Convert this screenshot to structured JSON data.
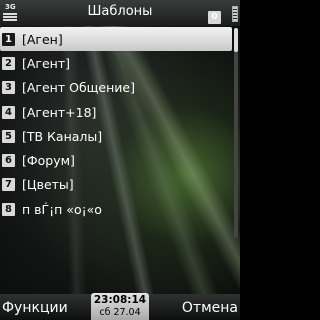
{
  "header": {
    "title": "Шаблоны",
    "battery_digit": "0",
    "signal_label": "3G"
  },
  "list": {
    "items": [
      {
        "num": "1",
        "label": "[Аген]"
      },
      {
        "num": "2",
        "label": "[Агент]"
      },
      {
        "num": "3",
        "label": "[Агент Общение]"
      },
      {
        "num": "4",
        "label": "[Агент+18]"
      },
      {
        "num": "5",
        "label": "[ТВ Каналы]"
      },
      {
        "num": "6",
        "label": "[Форум]"
      },
      {
        "num": "7",
        "label": "[Цветы]"
      },
      {
        "num": "8",
        "label": "п вЃ¡п «о¡«о"
      }
    ],
    "selected_index": 0
  },
  "softkeys": {
    "left": "Функции",
    "right": "Отмена"
  },
  "clock": {
    "time": "23:08:14",
    "date": "сб 27.04"
  }
}
